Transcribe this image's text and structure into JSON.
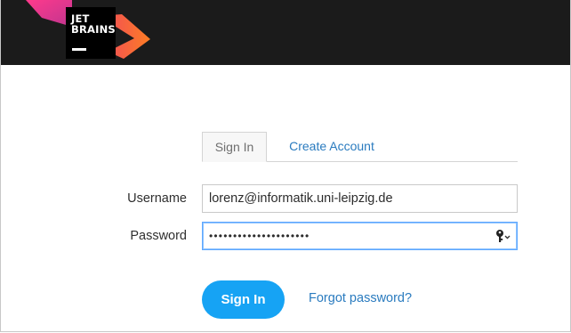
{
  "header": {
    "logo": {
      "line1": "JET",
      "line2": "BRAINS"
    },
    "colors": {
      "background": "#1b1b1b",
      "pink": "#ff318c",
      "orange": "#fc801d"
    }
  },
  "tabs": [
    {
      "label": "Sign In",
      "active": true
    },
    {
      "label": "Create Account",
      "active": false
    }
  ],
  "form": {
    "username_label": "Username",
    "username_value": "lorenz@informatik.uni-leipzig.de",
    "password_label": "Password",
    "password_masked": "•••••••••••••••••••••",
    "password_icon": "key-icon"
  },
  "actions": {
    "signin_label": "Sign In",
    "forgot_label": "Forgot password?"
  },
  "colors": {
    "accent": "#16a3f4",
    "link": "#2a7bbf"
  }
}
